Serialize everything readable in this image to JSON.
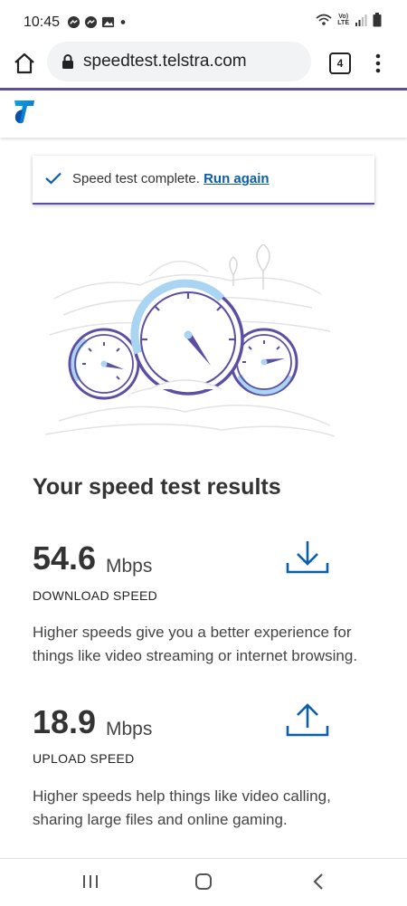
{
  "status_bar": {
    "time": "10:45",
    "notification_icons": [
      "messenger-icon",
      "messenger-icon",
      "image-icon",
      "dot-icon"
    ],
    "signal_text_top": "Vo)",
    "signal_text_bottom": "LTE"
  },
  "browser": {
    "url": "speedtest.telstra.com",
    "tab_count": "4"
  },
  "notice": {
    "text": "Speed test complete. ",
    "link": "Run again"
  },
  "results": {
    "title": "Your speed test results",
    "download": {
      "value": "54.6",
      "unit": "Mbps",
      "label": "DOWNLOAD SPEED",
      "description": "Higher speeds give you a better experience for things like video streaming or internet browsing."
    },
    "upload": {
      "value": "18.9",
      "unit": "Mbps",
      "label": "UPLOAD SPEED",
      "description": "Higher speeds help things like video calling, sharing large files and online gaming."
    }
  },
  "colors": {
    "accent_purple": "#5b4ea3",
    "link_blue": "#0b5ea8",
    "gauge_light_blue": "#a9d4f2"
  }
}
